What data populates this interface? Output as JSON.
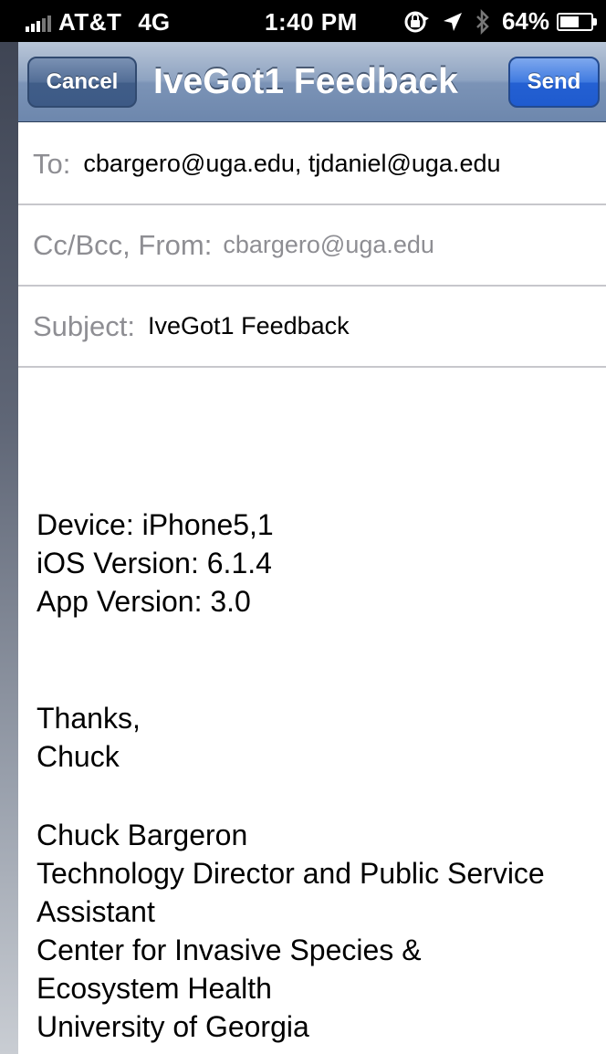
{
  "status_bar": {
    "carrier": "AT&T",
    "network": "4G",
    "time": "1:40 PM",
    "battery_percent": "64%",
    "battery_level": 0.64,
    "icons": [
      "signal-icon",
      "rotation-lock-icon",
      "location-arrow-icon",
      "bluetooth-icon",
      "battery-icon"
    ]
  },
  "nav": {
    "title": "IveGot1 Feedback",
    "cancel_label": "Cancel",
    "send_label": "Send"
  },
  "fields": {
    "to_label": "To:",
    "to_value": "cbargero@uga.edu, tjdaniel@uga.edu",
    "cc_label": "Cc/Bcc, From:",
    "cc_value": "cbargero@uga.edu",
    "subject_label": "Subject:",
    "subject_value": "IveGot1 Feedback"
  },
  "body": {
    "device_lines": [
      "Device: iPhone5,1",
      "iOS Version: 6.1.4",
      "App Version: 3.0"
    ],
    "closing_lines": [
      "Thanks,",
      "Chuck"
    ],
    "signature_lines": [
      "Chuck Bargeron",
      "Technology Director and Public Service",
      "Assistant",
      "Center for Invasive Species &",
      "Ecosystem Health",
      "University of Georgia"
    ]
  },
  "colors": {
    "nav_bar": "#7b93b6",
    "send_button": "#2460d2",
    "cancel_button": "#405d88",
    "label_gray": "#8e8e93"
  }
}
